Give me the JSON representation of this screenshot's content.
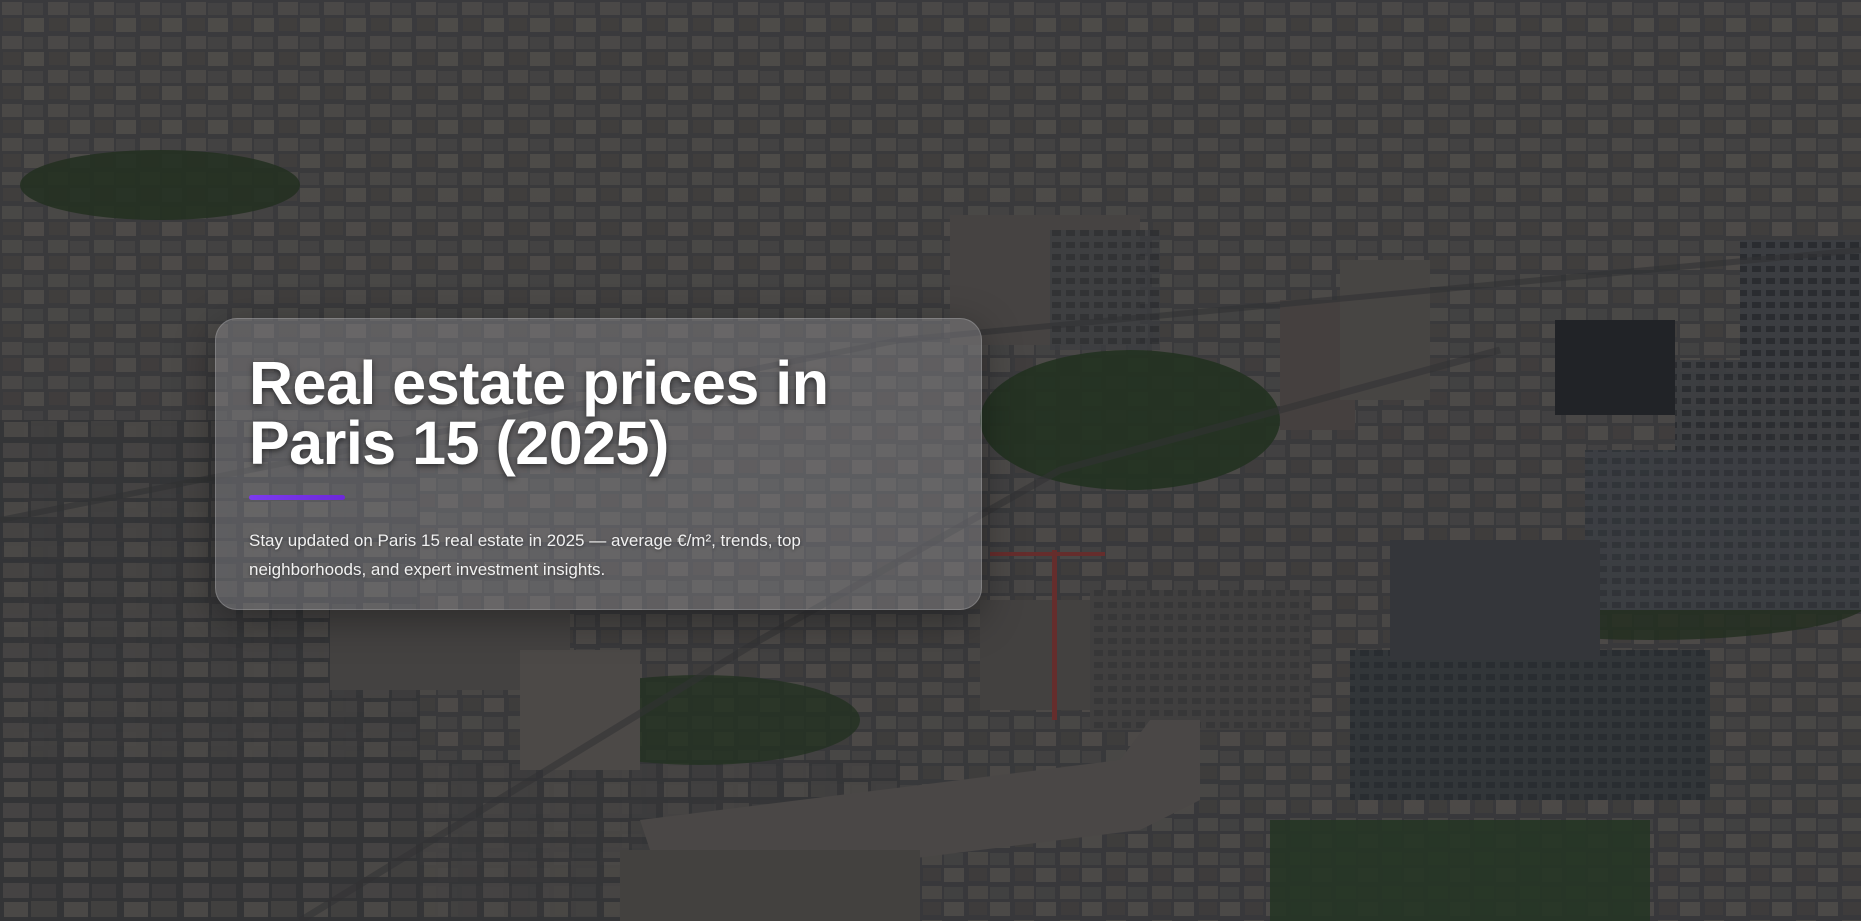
{
  "hero": {
    "title": "Real estate prices in Paris 15 (2025)",
    "description": "Stay updated on Paris 15 real estate in 2025 — average €/m², trends, top neighborhoods, and expert investment insights.",
    "background_image": "aerial-city-view",
    "accent_color": "#7c3aed"
  }
}
